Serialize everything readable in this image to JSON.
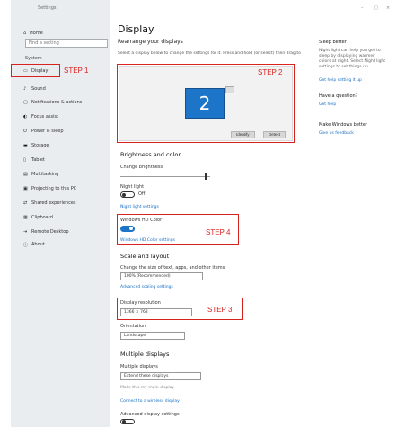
{
  "window": {
    "title": "Settings",
    "controls": {
      "minimize": "–",
      "maximize": "□",
      "close": "×"
    }
  },
  "sidebar": {
    "home_icon": "⌂",
    "home": "Home",
    "search_placeholder": "Find a setting",
    "group": "System",
    "items": [
      {
        "label": "Display",
        "icon": "▭"
      },
      {
        "label": "Sound",
        "icon": "♪"
      },
      {
        "label": "Notifications & actions",
        "icon": "▢"
      },
      {
        "label": "Focus assist",
        "icon": "◐"
      },
      {
        "label": "Power & sleep",
        "icon": "⏻"
      },
      {
        "label": "Storage",
        "icon": "▬"
      },
      {
        "label": "Tablet",
        "icon": "▯"
      },
      {
        "label": "Multitasking",
        "icon": "▤"
      },
      {
        "label": "Projecting to this PC",
        "icon": "▣"
      },
      {
        "label": "Shared experiences",
        "icon": "⇄"
      },
      {
        "label": "Clipboard",
        "icon": "▦"
      },
      {
        "label": "Remote Desktop",
        "icon": "⇥"
      },
      {
        "label": "About",
        "icon": "ⓘ"
      }
    ]
  },
  "steps": {
    "step1": "STEP 1",
    "step2": "STEP 2",
    "step3": "STEP 3",
    "step4": "STEP 4"
  },
  "main": {
    "title": "Display",
    "section": "Rearrange your displays",
    "instruction": "Select a display below to change the settings for it. Press and hold (or select) then drag to rearrange displays.",
    "preview": {
      "display_number": "2",
      "identify": "Identify",
      "detect": "Detect"
    },
    "brightness": {
      "heading": "Brightness and color",
      "label": "Change brightness",
      "night_light": "Night light",
      "night_light_state": "Off",
      "night_light_link": "Night light settings"
    },
    "hdr": {
      "label": "Windows HD Color",
      "link": "Windows HD Color settings"
    },
    "scale": {
      "heading": "Scale and layout",
      "label": "Change the size of text, apps, and other items",
      "value": "100% (Recommended)",
      "link": "Advanced scaling settings"
    },
    "resolution": {
      "label": "Display resolution",
      "value": "1366 × 768"
    },
    "orientation": {
      "label": "Orientation",
      "value": "Landscape"
    },
    "multiple": {
      "heading": "Multiple displays",
      "label": "Multiple displays",
      "value": "Extend these displays",
      "main_display": "Make this my main display",
      "wireless": "Connect to a wireless display",
      "advanced": "Advanced display settings"
    }
  },
  "right": {
    "sleep_heading": "Sleep better",
    "sleep_text": "Night light can help you get to sleep by displaying warmer colors at night. Select Night light settings to set things up.",
    "sleep_link": "Get help setting it up",
    "question_heading": "Have a question?",
    "question_link": "Get help",
    "feedback_heading": "Make Windows better",
    "feedback_link": "Give us feedback"
  },
  "colors": {
    "accent": "#1c75c9",
    "step": "#d9211e",
    "sidebar_bg": "#e9edf0"
  }
}
